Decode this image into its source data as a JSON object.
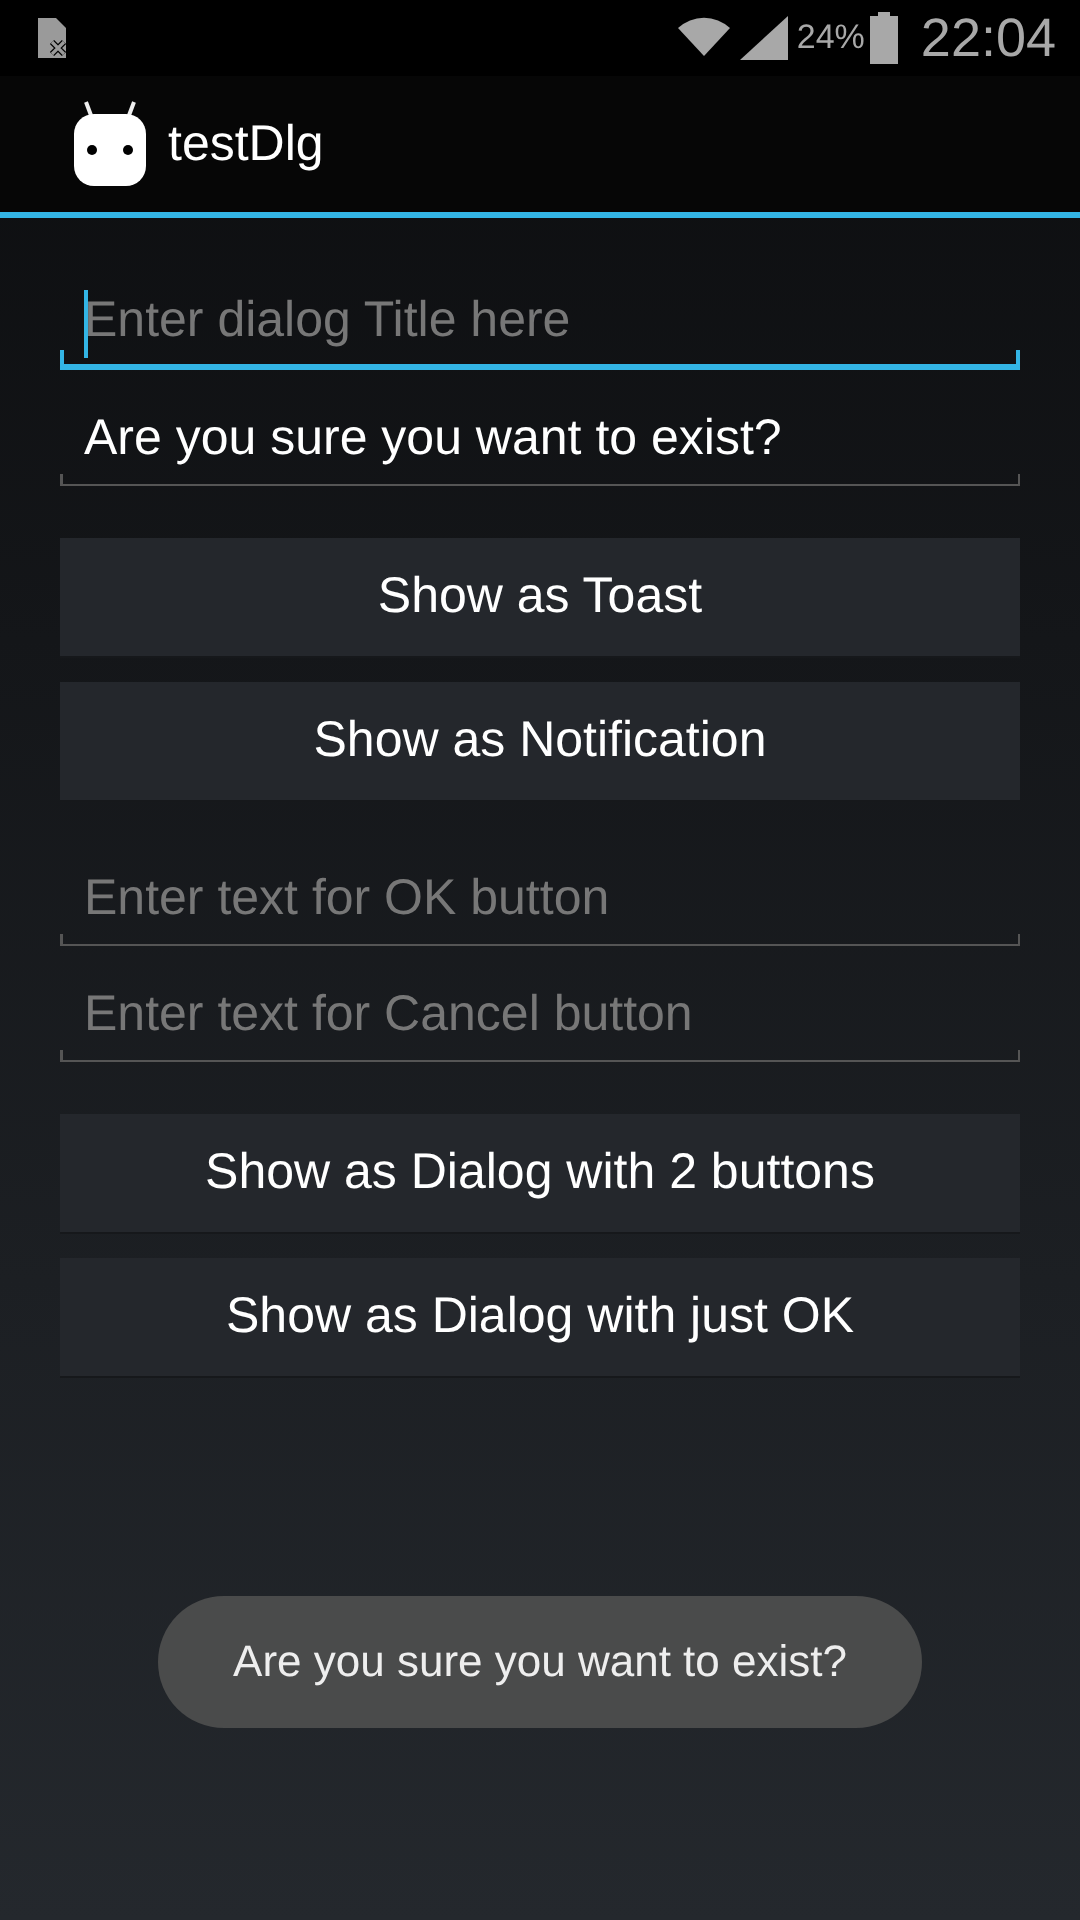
{
  "status_bar": {
    "battery": "24%",
    "time": "22:04"
  },
  "action_bar": {
    "title": "testDlg"
  },
  "controls": [
    {
      "kind": "field",
      "placeholder": "Enter dialog Title here",
      "focused": true
    },
    {
      "kind": "field",
      "value": "Are you sure you want to exist?",
      "focused": false
    },
    {
      "kind": "button",
      "label": "Show as Toast"
    },
    {
      "kind": "button",
      "label": "Show as Notification"
    },
    {
      "kind": "field",
      "placeholder": "Enter text for OK button",
      "focused": false
    },
    {
      "kind": "field",
      "placeholder": "Enter text for Cancel button",
      "focused": false
    },
    {
      "kind": "button",
      "label": "Show as Dialog with 2 buttons"
    },
    {
      "kind": "button",
      "label": "Show as Dialog with just OK"
    }
  ],
  "toast": {
    "text": "Are you sure you want to exist?"
  }
}
